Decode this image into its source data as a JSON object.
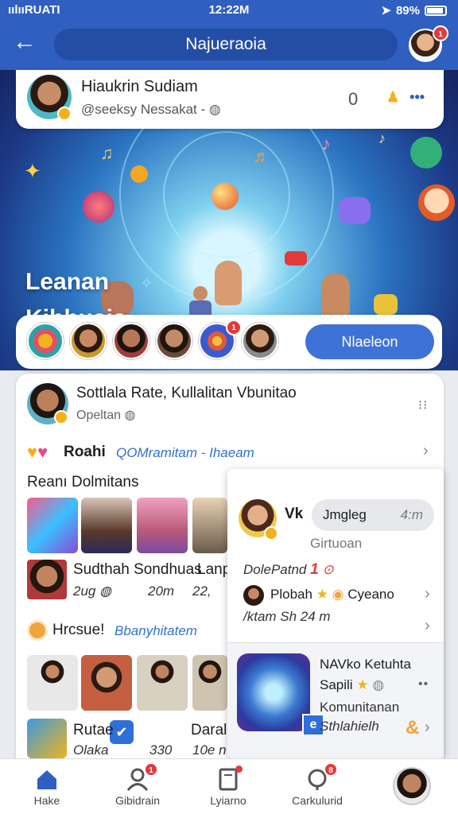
{
  "status": {
    "left": "ıılııRUATI",
    "time": "12:22M",
    "battery": "89%"
  },
  "appbar": {
    "title": "Najueraoia",
    "avatar_badge": "1"
  },
  "author": {
    "name": "Hiaukrin Sudiam",
    "handle": "@seeksy Nessakat -",
    "count": "0"
  },
  "hero": {
    "line1": "Leanan",
    "line2": "Kibhuaia"
  },
  "stories": {
    "button": "Nlaeleon",
    "badge": "1"
  },
  "post": {
    "title": "Sottlala Rate, Kullalitan Vbunitao",
    "subtitle": "Opeltan",
    "row1_label": "Roahi",
    "row1_link": "QOMramitam - Ihaeam",
    "section": "Reanı Dolmitans",
    "item1_title": "Sudthah Sondhuas",
    "item1_extra": "Lanp",
    "item1_meta": [
      "2ug",
      "20m",
      "22,"
    ],
    "row2_label": "Hrcsue!",
    "row2_link": "Bbanyhitatem",
    "item2_title": "Rutae",
    "item2_extra": "Daralc",
    "item2_meta": [
      "Olaka",
      "330",
      "10e n"
    ]
  },
  "popup": {
    "name": "Vk",
    "pill": "Jmgleg",
    "pill_right": "4:m",
    "sub": "Girtuoan",
    "line1": "DolePatnd",
    "line1_num": "1",
    "row_title": "Plobah",
    "row_right": "Cyeano",
    "row_sub": "/ktam Sh 24 m",
    "card_title": "NAVko Ketuhta",
    "card_sub": "Sapili",
    "card_line": "Komunitanan",
    "card_line2": "Sthlahielh"
  },
  "nav": [
    {
      "label": "Hake",
      "icon": "home-icon"
    },
    {
      "label": "Gibidrain",
      "icon": "people-icon",
      "badge": "1"
    },
    {
      "label": "Lyiarno",
      "icon": "book-icon"
    },
    {
      "label": "Carkulurid",
      "icon": "bell-icon",
      "badge": "8"
    }
  ]
}
